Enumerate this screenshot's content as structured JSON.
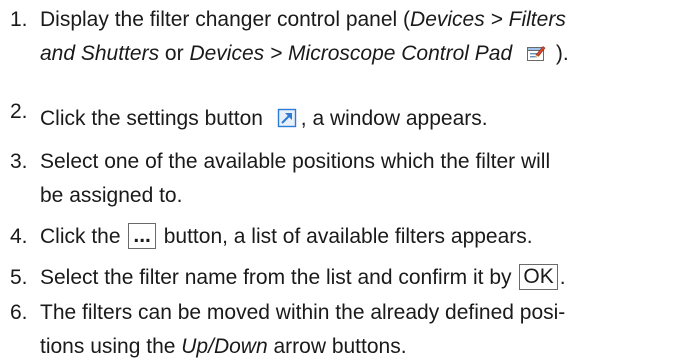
{
  "steps": [
    {
      "number": "1.",
      "line1": "Display the filter changer control panel (",
      "line1_em1": "Devices > Filters",
      "line2_em": "and Shutters",
      "line2_mid": " or ",
      "line2_em2": "Devices > Microscope Control Pad",
      "line2_end": " )."
    },
    {
      "number": "2.",
      "before": "Click the settings button",
      "after": ", a window appears."
    },
    {
      "number": "3.",
      "line1": "Select one of the available positions which the filter will",
      "line2": "be assigned to."
    },
    {
      "number": "4.",
      "before": "Click the",
      "button_label": "...",
      "after": "button, a list of available filters appears."
    },
    {
      "number": "5.",
      "before": "Select the filter name from the list and confirm it by",
      "button_label": "OK",
      "after": "."
    },
    {
      "number": "6.",
      "line1": "The filters can be moved within the already defined posi-",
      "line2_before": "tions using the ",
      "line2_em": "Up/Down",
      "line2_after": " arrow buttons."
    }
  ],
  "icons": {
    "control_pad": "control-pad-icon",
    "settings": "settings-expand-icon",
    "accent": "#2e7bd6"
  }
}
